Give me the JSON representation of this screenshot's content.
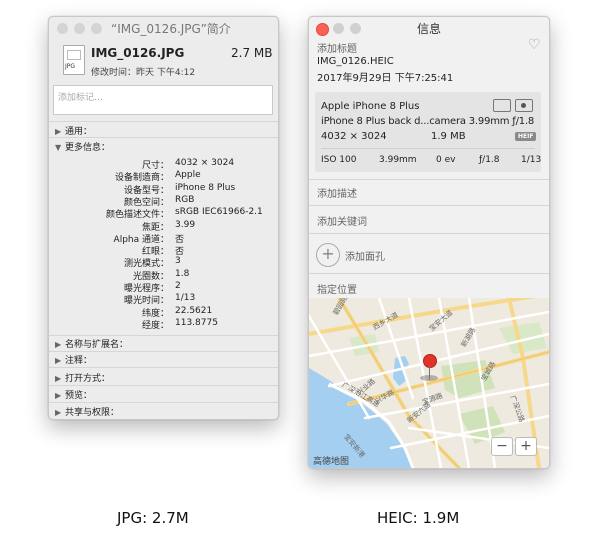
{
  "jpg_window": {
    "title": "“IMG_0126.JPG”简介",
    "file_icon_label": "JPG",
    "file_name": "IMG_0126.JPG",
    "file_size": "2.7 MB",
    "modified": "修改时间：昨天 下午4:12",
    "tags_placeholder": "添加标记…",
    "sections": {
      "general": "通用：",
      "more_info": "更多信息：",
      "name_ext": "名称与扩展名：",
      "comments": "注释：",
      "open_with": "打开方式：",
      "preview": "预览：",
      "sharing": "共享与权限："
    },
    "info_rows": [
      {
        "label": "尺寸：",
        "value": "4032 × 3024"
      },
      {
        "label": "设备制造商：",
        "value": "Apple"
      },
      {
        "label": "设备型号：",
        "value": "iPhone 8 Plus"
      },
      {
        "label": "颜色空间：",
        "value": "RGB"
      },
      {
        "label": "颜色描述文件：",
        "value": "sRGB IEC61966-2.1"
      },
      {
        "label": "焦距：",
        "value": "3.99"
      },
      {
        "label": "Alpha 通道：",
        "value": "否"
      },
      {
        "label": "红眼：",
        "value": "否"
      },
      {
        "label": "测光模式：",
        "value": "3"
      },
      {
        "label": "光圈数：",
        "value": "1.8"
      },
      {
        "label": "曝光程序：",
        "value": "2"
      },
      {
        "label": "曝光时间：",
        "value": "1/13"
      },
      {
        "label": "纬度：",
        "value": "22.5621"
      },
      {
        "label": "经度：",
        "value": "113.8775"
      }
    ]
  },
  "heic_window": {
    "title": "信息",
    "add_title": "添加标题",
    "file_name": "IMG_0126.HEIC",
    "date": "2017年9月29日   下午7:25:41",
    "device": "Apple iPhone 8 Plus",
    "camera": "iPhone 8 Plus back d...camera 3.99mm ƒ/1.8",
    "dimensions": "4032 × 3024",
    "size": "1.9 MB",
    "format_badge": "HEIF",
    "exif": [
      "ISO 100",
      "3.99mm",
      "0 ev",
      "ƒ/1.8",
      "1/13"
    ],
    "add_description": "添加描述",
    "add_keywords": "添加关键词",
    "add_faces": "添加面孔",
    "add_faces_icon": "+",
    "location": "指定位置",
    "map_attribution": "高德地图",
    "zoom_out": "−",
    "zoom_in": "+",
    "map_labels": [
      {
        "text": "碧园路"
      },
      {
        "text": "西乡大道"
      },
      {
        "text": "宝安大道"
      },
      {
        "text": "新湖路"
      },
      {
        "text": "兴业路"
      },
      {
        "text": "兴华路"
      },
      {
        "text": "宝源路"
      },
      {
        "text": "新安六路"
      },
      {
        "text": "宝城路"
      },
      {
        "text": "广深公路"
      },
      {
        "text": "广深沿江高速"
      },
      {
        "text": "宝安新港"
      }
    ]
  },
  "captions": {
    "jpg": "JPG: 2.7M",
    "heic": "HEIC: 1.9M"
  },
  "colors": {
    "close": "#fd5f57",
    "inactive": "#d0d0d0",
    "pin": "#e2332a",
    "water": "#a5cff0"
  }
}
